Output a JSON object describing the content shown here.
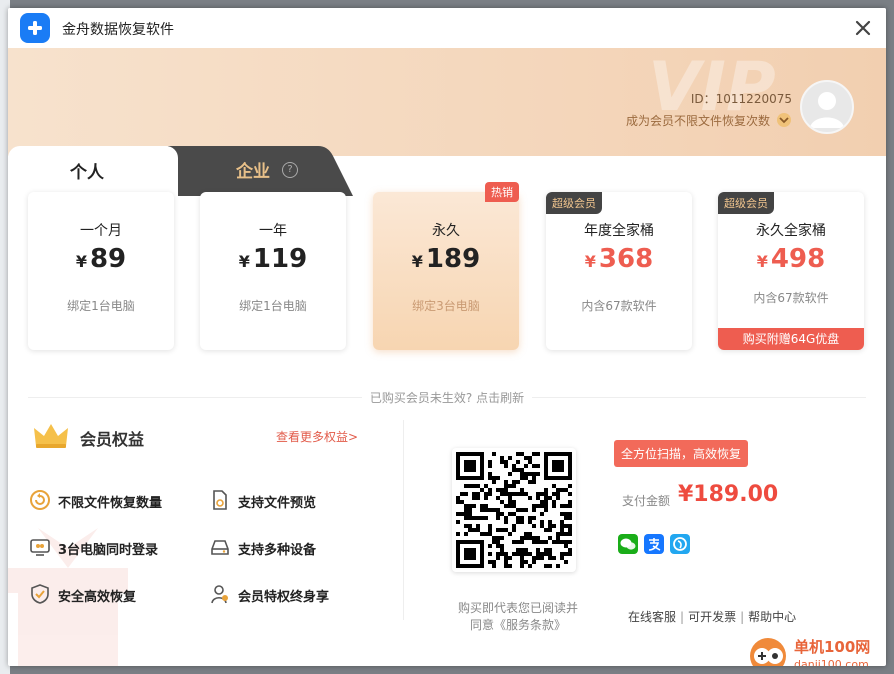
{
  "app": {
    "title": "金舟数据恢复软件"
  },
  "header": {
    "watermark": "VIP",
    "user_id": "ID：1011220075",
    "member_hint": "成为会员不限文件恢复次数"
  },
  "tabs": [
    {
      "label": "个人",
      "active": true
    },
    {
      "label": "企业",
      "active": false
    }
  ],
  "plans": [
    {
      "name": "一个月",
      "currency": "¥",
      "price": "89",
      "desc": "绑定1台电脑",
      "badge": "",
      "extra": ""
    },
    {
      "name": "一年",
      "currency": "¥",
      "price": "119",
      "desc": "绑定1台电脑",
      "badge": "",
      "extra": ""
    },
    {
      "name": "永久",
      "currency": "¥",
      "price": "189",
      "desc": "绑定3台电脑",
      "badge": "热销",
      "extra": ""
    },
    {
      "name": "年度全家桶",
      "currency": "¥",
      "price": "368",
      "desc": "内含67款软件",
      "badge": "超级会员",
      "extra": ""
    },
    {
      "name": "永久全家桶",
      "currency": "¥",
      "price": "498",
      "desc": "内含67款软件",
      "badge": "超级会员",
      "extra": "购买附赠64G优盘"
    }
  ],
  "refresh_text": "已购买会员未生效? 点击刷新",
  "benefits": {
    "title": "会员权益",
    "more_link": "查看更多权益>",
    "items": [
      {
        "label": "不限文件恢复数量",
        "icon": "refresh-icon"
      },
      {
        "label": "支持文件预览",
        "icon": "file-preview-icon"
      },
      {
        "label": "3台电脑同时登录",
        "icon": "multi-device-icon"
      },
      {
        "label": "支持多种设备",
        "icon": "drive-icon"
      },
      {
        "label": "安全高效恢复",
        "icon": "shield-check-icon"
      },
      {
        "label": "会员特权终身享",
        "icon": "user-privilege-icon"
      }
    ]
  },
  "payment": {
    "scan_tag": "全方位扫描，高效恢复",
    "amount_label": "支付金额",
    "amount": "¥189.00",
    "methods": [
      "wechat-pay-icon",
      "alipay-icon",
      "bank-pay-icon"
    ],
    "agree_line1": "购买即代表您已阅读并",
    "agree_line2": "同意《服务条款》"
  },
  "footer": {
    "links": [
      "在线客服",
      "可开发票",
      "帮助中心"
    ]
  },
  "site_watermark": {
    "name": "单机100网",
    "url": "danji100.com"
  },
  "colors": {
    "accent": "#ee5d50",
    "brand": "#1a7cf5",
    "gold": "#e8c089"
  }
}
